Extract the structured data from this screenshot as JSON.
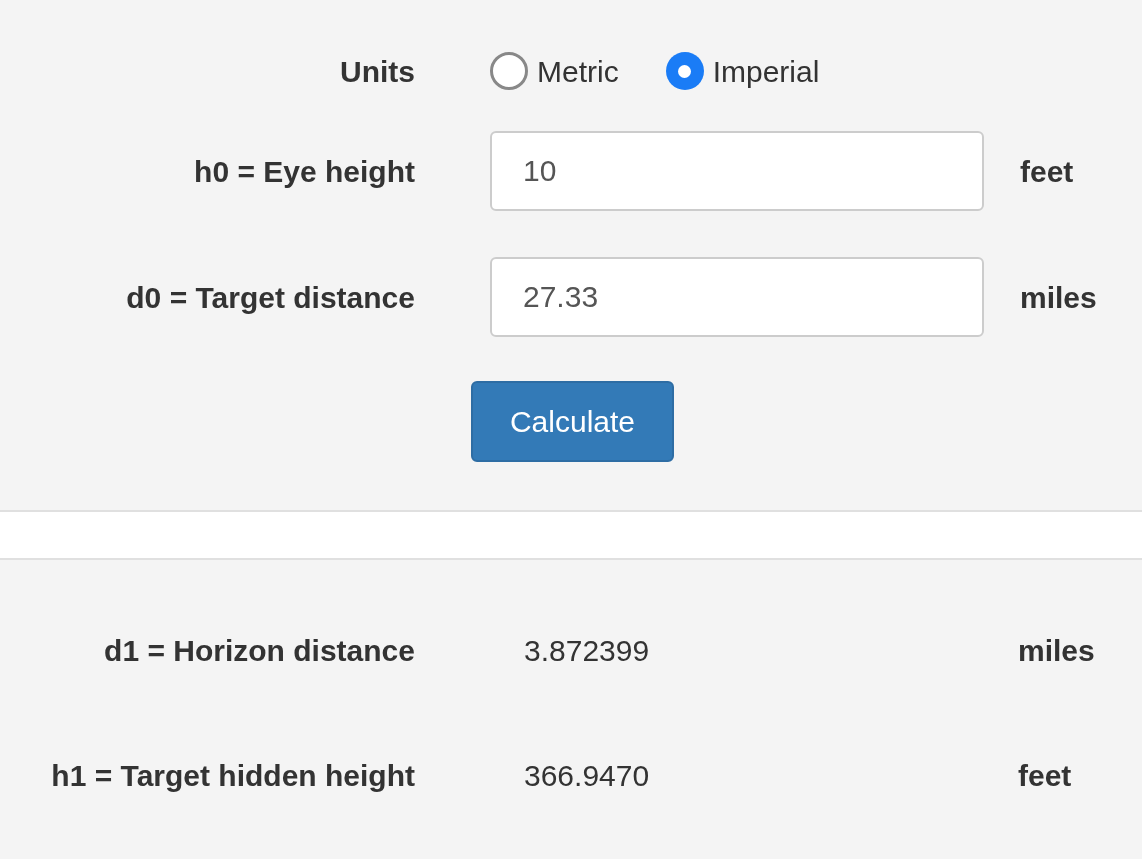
{
  "units": {
    "label": "Units",
    "options": [
      {
        "label": "Metric",
        "selected": false
      },
      {
        "label": "Imperial",
        "selected": true
      }
    ]
  },
  "inputs": [
    {
      "label": "h0 = Eye height",
      "value": "10",
      "unit": "feet"
    },
    {
      "label": "d0 = Target distance",
      "value": "27.33",
      "unit": "miles"
    }
  ],
  "button": "Calculate",
  "results": [
    {
      "label": "d1 = Horizon distance",
      "value": "3.872399",
      "unit": "miles"
    },
    {
      "label": "h1 = Target hidden height",
      "value": "366.9470",
      "unit": "feet"
    }
  ]
}
